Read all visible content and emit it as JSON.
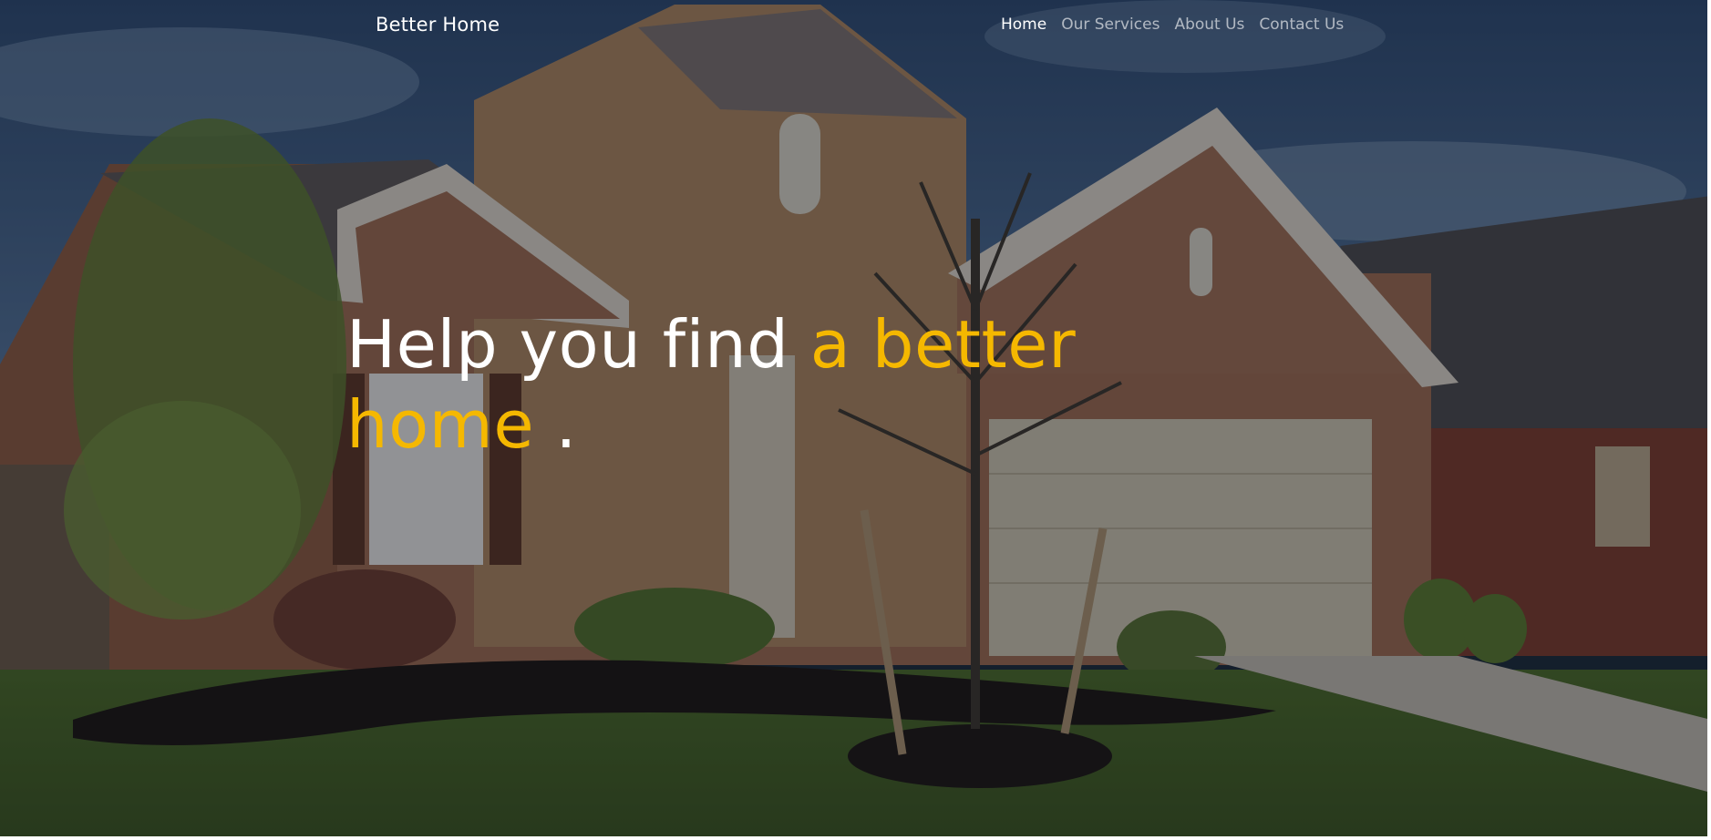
{
  "navbar": {
    "brand": "Better Home",
    "links": [
      {
        "label": "Home",
        "active": true
      },
      {
        "label": "Our Services",
        "active": false
      },
      {
        "label": "About Us",
        "active": false
      },
      {
        "label": "Contact Us",
        "active": false
      }
    ]
  },
  "hero": {
    "headline_part1": "Help you find ",
    "headline_accent1": "a better",
    "headline_accent2": "home",
    "headline_end": " ."
  },
  "colors": {
    "accent": "#f5b800",
    "text": "#ffffff",
    "nav_inactive": "rgba(255,255,255,0.62)"
  }
}
